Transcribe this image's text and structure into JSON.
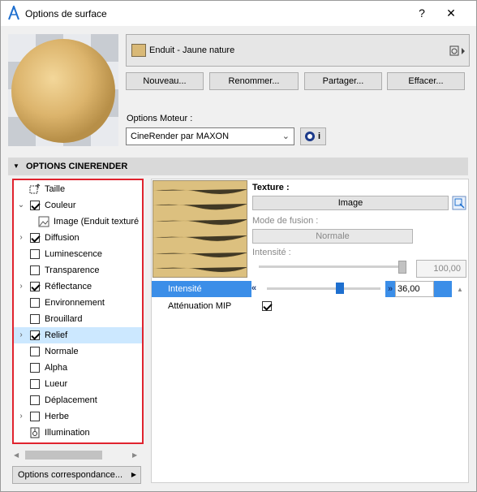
{
  "window": {
    "title": "Options de surface",
    "help_label": "?",
    "close_label": "✕"
  },
  "material": {
    "name": "Enduit - Jaune nature",
    "swatch_color": "#d9b977"
  },
  "buttons": {
    "new": "Nouveau...",
    "rename": "Renommer...",
    "share": "Partager...",
    "delete": "Effacer..."
  },
  "engine": {
    "label": "Options Moteur :",
    "value": "CineRender par MAXON",
    "info_label": "i"
  },
  "section": {
    "title": "OPTIONS CINERENDER"
  },
  "tree": {
    "items": [
      {
        "label": "Taille",
        "checkbox": "none",
        "expander": false
      },
      {
        "label": "Couleur",
        "checkbox": "checked",
        "expander": "open"
      },
      {
        "label": "Image (Enduit texturé",
        "checkbox": "none",
        "expander": false
      },
      {
        "label": "Diffusion",
        "checkbox": "checked",
        "expander": "closed"
      },
      {
        "label": "Luminescence",
        "checkbox": "unchecked",
        "expander": false
      },
      {
        "label": "Transparence",
        "checkbox": "unchecked",
        "expander": false
      },
      {
        "label": "Réflectance",
        "checkbox": "checked",
        "expander": "closed"
      },
      {
        "label": "Environnement",
        "checkbox": "unchecked",
        "expander": false
      },
      {
        "label": "Brouillard",
        "checkbox": "unchecked",
        "expander": false
      },
      {
        "label": "Relief",
        "checkbox": "checked",
        "expander": "closed"
      },
      {
        "label": "Normale",
        "checkbox": "unchecked",
        "expander": false
      },
      {
        "label": "Alpha",
        "checkbox": "unchecked",
        "expander": false
      },
      {
        "label": "Lueur",
        "checkbox": "unchecked",
        "expander": false
      },
      {
        "label": "Déplacement",
        "checkbox": "unchecked",
        "expander": false
      },
      {
        "label": "Herbe",
        "checkbox": "unchecked",
        "expander": "closed"
      },
      {
        "label": "Illumination",
        "checkbox": "none",
        "expander": false
      }
    ],
    "selected": "Relief"
  },
  "match_options": {
    "label": "Options correspondance..."
  },
  "texture": {
    "label": "Texture :",
    "image_button": "Image",
    "blend_label": "Mode de fusion :",
    "blend_value": "Normale",
    "intensity_label": "Intensité :",
    "intensity_value": "100,00",
    "intensity_level": 100
  },
  "relief": {
    "intensity_label": "Intensité",
    "intensity_value": "36,00",
    "intensity_level": 36,
    "mip_label": "Atténuation MIP",
    "mip_checked": true
  },
  "colors": {
    "highlight": "#3b8ee8",
    "tree_selection": "#cce8ff",
    "tree_border": "#e0232e"
  }
}
